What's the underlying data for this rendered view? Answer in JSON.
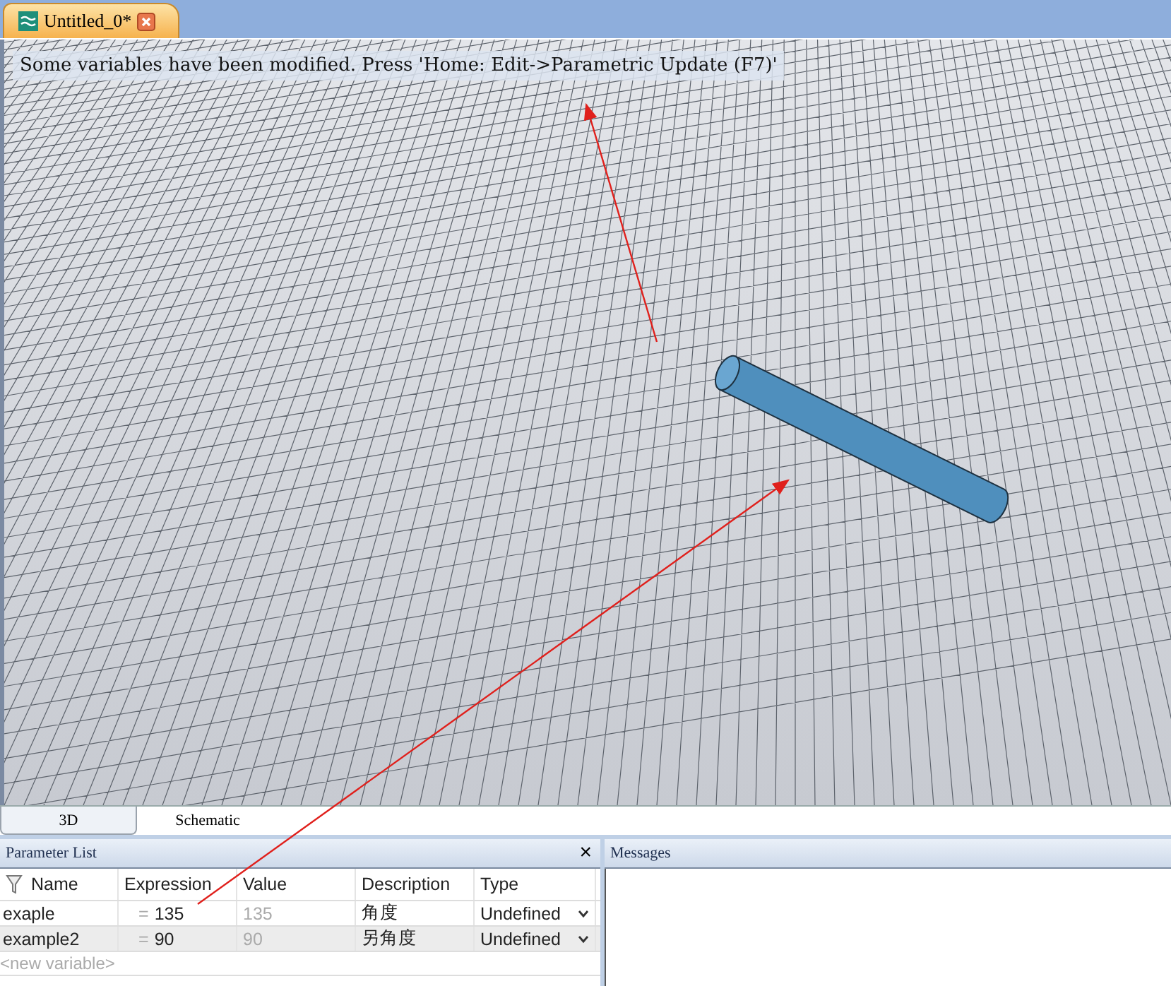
{
  "document_tab": {
    "title": "Untitled_0*",
    "selected": true
  },
  "viewport": {
    "notice": "Some variables have been modified. Press 'Home: Edit->Parametric Update (F7)'"
  },
  "view_tabs": [
    {
      "label": "3D",
      "selected": true
    },
    {
      "label": "Schematic",
      "selected": false
    }
  ],
  "parameter_list": {
    "title": "Parameter List",
    "close": "×",
    "columns": [
      "Name",
      "Expression",
      "Value",
      "Description",
      "Type"
    ],
    "rows": [
      {
        "name": "exaple",
        "operator": "=",
        "expression": "135",
        "value": "135",
        "description": "角度",
        "type": "Undefined",
        "selected": false
      },
      {
        "name": "example2",
        "operator": "=",
        "expression": "90",
        "value": "90",
        "description": "另角度",
        "type": "Undefined",
        "selected": true
      }
    ],
    "new_row_placeholder": "<new variable>"
  },
  "messages": {
    "title": "Messages"
  }
}
